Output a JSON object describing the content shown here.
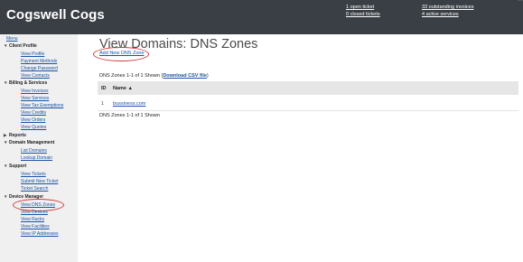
{
  "header": {
    "brand": "Cogswell Cogs",
    "cutoff_text": "…",
    "tickets": {
      "open": "1 open ticket",
      "closed": "0 closed tickets"
    },
    "billing": {
      "invoices": "33 outstanding invoices",
      "services": "4 active services"
    }
  },
  "sidebar": {
    "menu_label": "Menu",
    "groups": {
      "client_profile": {
        "label": "Client Profile",
        "items": [
          "View Profile",
          "Payment Methods",
          "Change Password",
          "View Contacts"
        ]
      },
      "billing": {
        "label": "Billing & Services",
        "items": [
          "View Invoices",
          "View Services",
          "View Tax Exemptions",
          "View Credits",
          "View Orders",
          "View Quotes"
        ]
      },
      "reports": {
        "label": "Reports"
      },
      "domain": {
        "label": "Domain Management",
        "items": [
          "List Domains",
          "Lookup Domain"
        ]
      },
      "support": {
        "label": "Support",
        "items": [
          "View Tickets",
          "Submit New Ticket",
          "Ticket Search"
        ]
      },
      "device": {
        "label": "Device Manager",
        "items": [
          "View DNS Zones",
          "View Devices",
          "View Racks",
          "View Facilities",
          "View IP Addresses"
        ]
      }
    }
  },
  "main": {
    "title": "View Domains: DNS Zones",
    "add_link": "Add New DNS Zone",
    "summary_prefix": "DNS Zones 1-1 of 1 Shown (",
    "download_link": "Download CSV file",
    "summary_suffix": ")",
    "table": {
      "headers": {
        "id": "ID",
        "name": "Name ▲"
      },
      "rows": [
        {
          "id": "1",
          "name": "bussiness.com"
        }
      ]
    },
    "footer_summary": "DNS Zones 1-1 of 1 Shown"
  },
  "colors": {
    "header_bg": "#3a3f45",
    "link": "#1a52a3",
    "highlight_circle": "#d23b3b"
  }
}
